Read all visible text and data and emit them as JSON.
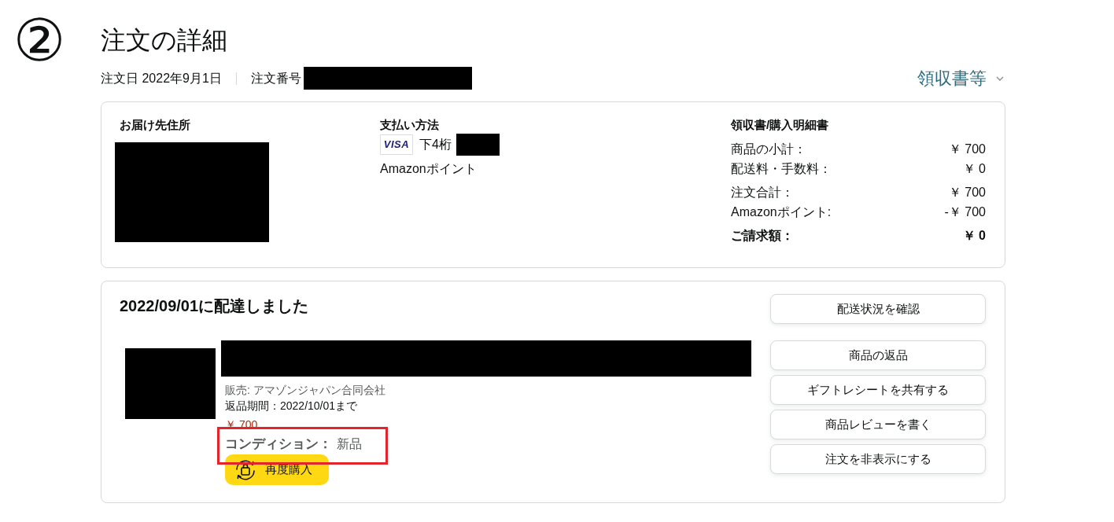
{
  "step_marker": "②",
  "page_title": "注文の詳細",
  "order_meta": {
    "date": "注文日 2022年9月1日",
    "number_label": "注文番号",
    "number": {
      "redacted": true
    }
  },
  "receipts_menu": {
    "label": "領収書等"
  },
  "summary": {
    "shipping_address": {
      "heading": "お届け先住所",
      "address": {
        "redacted": true
      }
    },
    "payment": {
      "heading": "支払い方法",
      "card_brand": "VISA",
      "last4_label": "下4桁",
      "last4": {
        "redacted": true
      },
      "other_method": "Amazonポイント"
    },
    "receipt": {
      "heading": "領収書/購入明細書",
      "sections": [
        {
          "rows": [
            {
              "kind": "line",
              "label": "商品の小計：",
              "amount": "￥ 700"
            },
            {
              "kind": "line",
              "label": "配送料・手数料：",
              "amount": "￥ 0"
            }
          ]
        },
        {
          "rows": [
            {
              "kind": "line",
              "label": "注文合計：",
              "amount": "￥ 700"
            },
            {
              "kind": "line",
              "label": "Amazonポイント:",
              "amount": "-￥ 700"
            }
          ]
        },
        {
          "rows": [
            {
              "kind": "total",
              "label": "ご請求額：",
              "amount": "￥ 0"
            }
          ]
        }
      ]
    }
  },
  "shipment": {
    "heading": "2022/09/01に配達しました",
    "item": {
      "image": {
        "redacted": true
      },
      "title": {
        "redacted": true
      },
      "seller": "販売: アマゾンジャパン合同会社",
      "return_window": "返品期間：2022/10/01まで",
      "price": "￥ 700",
      "condition_label": "コンディション：",
      "condition": "新品",
      "condition_highlighted": true,
      "buy_again_button": "再度購入"
    },
    "action_groups": [
      {
        "buttons": [
          "配送状況を確認"
        ]
      },
      {
        "buttons": [
          "商品の返品",
          "ギフトレシートを共有する",
          "商品レビューを書く",
          "注文を非表示にする"
        ]
      }
    ]
  }
}
